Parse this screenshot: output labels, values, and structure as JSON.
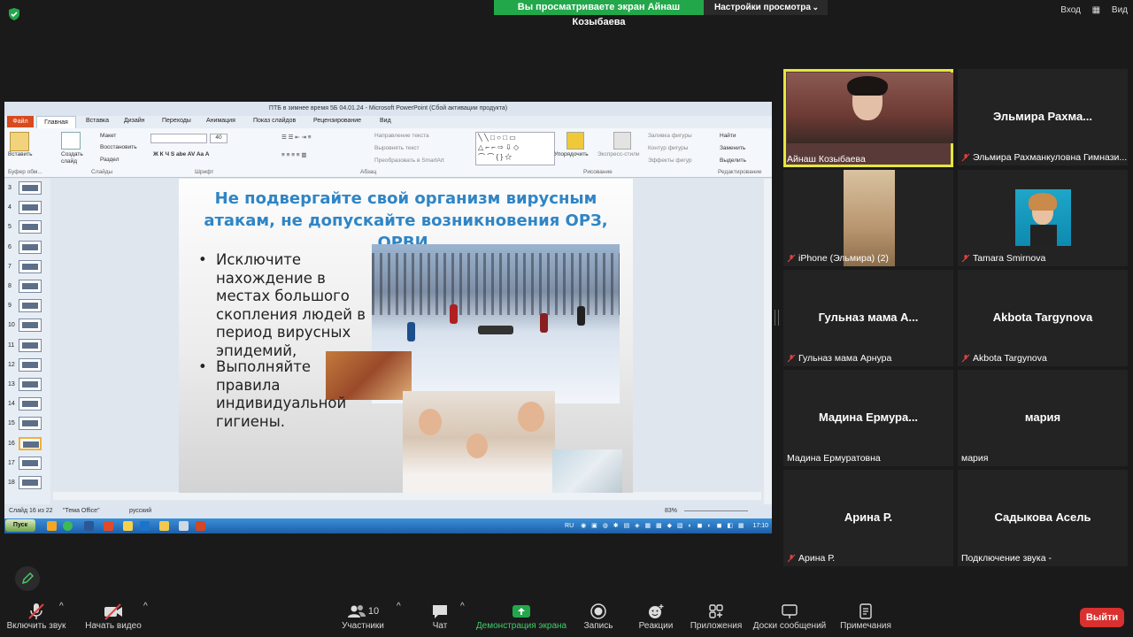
{
  "top": {
    "share_banner": "Вы просматриваете экран Айнаш Козыбаева",
    "view_settings": "Настройки просмотра",
    "enter": "Вход",
    "view": "Вид"
  },
  "ppt": {
    "title": "ПТБ в зимнее время 5Б 04.01.24 - Microsoft PowerPoint (Сбой активации продукта)",
    "tabs": [
      "Файл",
      "Главная",
      "Вставка",
      "Дизайн",
      "Переходы",
      "Анимация",
      "Показ слайдов",
      "Рецензирование",
      "Вид"
    ],
    "ribbon": {
      "paste": "Вставить",
      "clipboard": "Буфер обм...",
      "create_slide": "Создать слайд",
      "layout": "Макет",
      "restore": "Восстановить",
      "section": "Раздел",
      "slides": "Слайды",
      "font": "Шрифт",
      "paragraph": "Абзац",
      "text_direction": "Направление текста",
      "align_text": "Выровнять текст",
      "smartart": "Преобразовать в SmartArt",
      "arrange": "Упорядочить",
      "quick_styles": "Экспресс-стили",
      "shape_fill": "Заливка фигуры",
      "shape_outline": "Контур фигуры",
      "shape_effects": "Эффекты фигур",
      "drawing": "Рисование",
      "find": "Найти",
      "replace": "Заменить",
      "select": "Выделить",
      "editing": "Редактирование",
      "font_size": "40"
    },
    "thumb_numbers": [
      "3",
      "4",
      "5",
      "6",
      "7",
      "8",
      "9",
      "10",
      "11",
      "12",
      "13",
      "14",
      "15",
      "16",
      "17",
      "18"
    ],
    "active_thumb": "16",
    "slide": {
      "title": "Не подвергайте свой организм вирусным атакам, не допускайте возникновения ОРЗ, ОРВИ.",
      "bullets": [
        "Исключите нахождение в местах большого скопления людей в период вирусных эпидемий,",
        "Выполняйте правила индивидуальной гигиены."
      ]
    },
    "status": {
      "slide_num": "Слайд 16 из 22",
      "theme": "\"Тема Office\"",
      "lang": "русский",
      "zoom": "83%"
    },
    "taskbar": {
      "start": "Пуск",
      "lang": "RU",
      "time": "17:10"
    }
  },
  "participants": [
    {
      "big": "",
      "label": "Айнаш Козыбаева",
      "muted": false,
      "video": true
    },
    {
      "big": "Эльмира  Рахма...",
      "label": "Эльмира Рахманкуловна Гимнази...",
      "muted": true
    },
    {
      "big": "",
      "label": "iPhone (Эльмира) (2)",
      "muted": true,
      "video": true
    },
    {
      "big": "",
      "label": "Tamara Smirnova",
      "muted": true,
      "video": true
    },
    {
      "big": "Гульназ мама  А...",
      "label": "Гульназ мама Арнура",
      "muted": true
    },
    {
      "big": "Akbota Targynova",
      "label": "Akbota Targynova",
      "muted": true
    },
    {
      "big": "Мадина  Ермура...",
      "label": "Мадина Ермуратовна",
      "muted": false
    },
    {
      "big": "мария",
      "label": "мария",
      "muted": false
    },
    {
      "big": "Арина Р.",
      "label": "Арина Р.",
      "muted": true
    },
    {
      "big": "Садыкова Асель",
      "label": "Подключение звука -",
      "muted": false
    }
  ],
  "toolbar": {
    "audio": "Включить звук",
    "video": "Начать видео",
    "participants": "Участники",
    "participants_count": "10",
    "chat": "Чат",
    "share": "Демонстрация экрана",
    "record": "Запись",
    "reactions": "Реакции",
    "apps": "Приложения",
    "whiteboard": "Доски сообщений",
    "notes": "Примечания",
    "leave": "Выйти"
  },
  "colors": {
    "share_green": "#23a74b",
    "leave_red": "#d9312f",
    "active_speaker": "#e6e63d",
    "slide_title_blue": "#2f85c6"
  }
}
